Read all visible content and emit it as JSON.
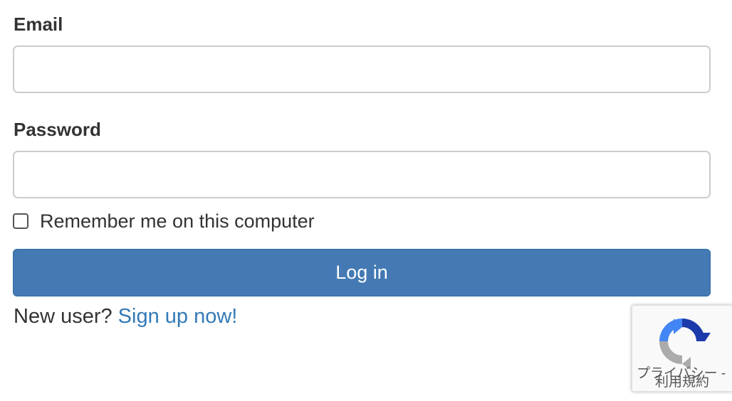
{
  "form": {
    "email_label": "Email",
    "email_value": "",
    "password_label": "Password",
    "password_value": "",
    "remember_label": "Remember me on this computer",
    "remember_checked": false,
    "login_label": "Log in",
    "new_user_text": "New user? ",
    "signup_link": "Sign up now!"
  },
  "recaptcha": {
    "privacy_label": "プライバシー",
    "separator": " -",
    "terms_label": "利用規約",
    "logo_icon": "recaptcha-icon"
  },
  "colors": {
    "primary_button": "#4479b3",
    "link": "#337ab7",
    "text": "#333333",
    "input_border": "#cccccc"
  }
}
